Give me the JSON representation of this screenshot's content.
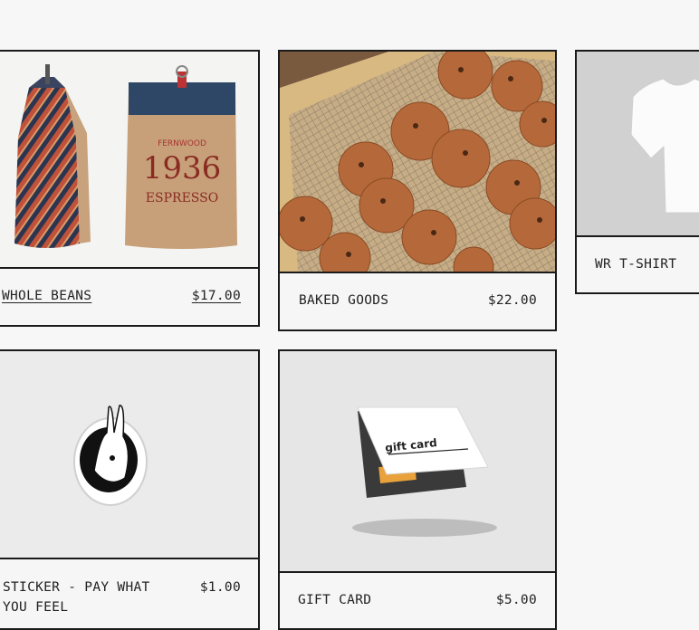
{
  "products": [
    {
      "name": "WHOLE BEANS",
      "price": "$17.00",
      "bag_brand": "FERNWOOD",
      "bag_year": "1936",
      "bag_type": "ESPRESSO"
    },
    {
      "name": "BAKED GOODS",
      "price": "$22.00"
    },
    {
      "name": "WR T-SHIRT",
      "price": ""
    },
    {
      "name": "STICKER - PAY WHAT YOU FEEL",
      "price": "$1.00"
    },
    {
      "name": "GIFT CARD",
      "price": "$5.00",
      "card_text": "gift card"
    }
  ],
  "colors": {
    "page_bg": "#f7f7f7",
    "border": "#1a1a1a",
    "text": "#222222"
  }
}
